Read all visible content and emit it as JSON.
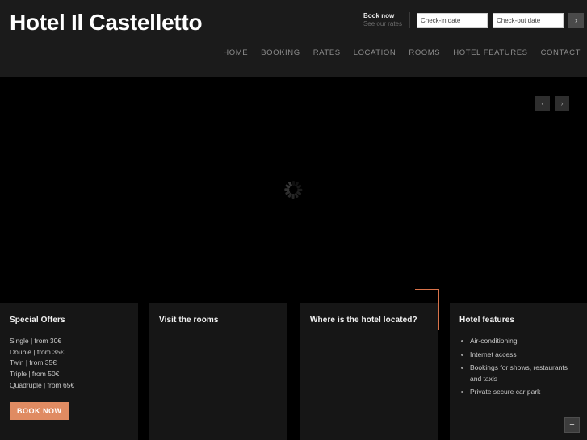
{
  "site": {
    "title": "Hotel Il Castelletto"
  },
  "booking_widget": {
    "book_now_label": "Book now",
    "see_rates_label": "See our rates",
    "checkin_placeholder": "Check-in date",
    "checkin_value": "",
    "checkout_placeholder": "Check-out date",
    "checkout_value": "",
    "submit_icon": "›"
  },
  "nav": {
    "items": [
      {
        "label": "HOME"
      },
      {
        "label": "BOOKING"
      },
      {
        "label": "RATES"
      },
      {
        "label": "LOCATION"
      },
      {
        "label": "ROOMS"
      },
      {
        "label": "HOTEL FEATURES"
      },
      {
        "label": "CONTACT"
      }
    ]
  },
  "slider": {
    "prev_icon": "‹",
    "next_icon": "›",
    "status": "loading"
  },
  "panels": {
    "special_offers": {
      "title": "Special Offers",
      "offers": [
        "Single | from 30€",
        "Double | from 35€",
        "Twin | from 35€",
        "Triple | from 50€",
        "Quadruple | from 65€"
      ],
      "cta_label": "BOOK NOW"
    },
    "visit_rooms": {
      "title": "Visit the rooms"
    },
    "location": {
      "title": "Where is the hotel located?"
    },
    "hotel_features": {
      "title": "Hotel features",
      "features": [
        "Air-conditioning",
        "Internet access",
        "Bookings for shows, restaurants and taxis",
        "Private secure car park"
      ],
      "expand_label": "+"
    }
  },
  "colors": {
    "accent": "#d9734a",
    "cta": "#e08b62",
    "header_bg": "#1b1b1b",
    "panel_bg": "#161616",
    "page_bg": "#000000"
  }
}
